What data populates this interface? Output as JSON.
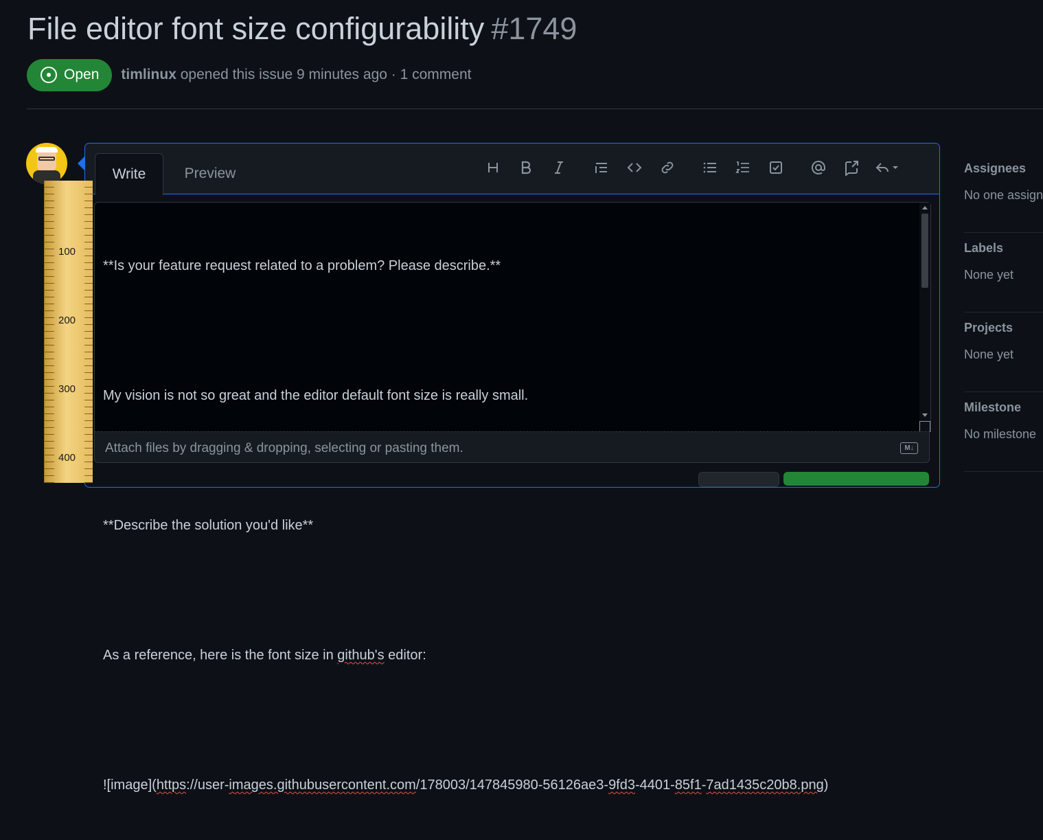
{
  "issue": {
    "title": "File editor font size configurability",
    "number": "#1749",
    "state": "Open",
    "author": "timlinux",
    "meta_rest": " opened this issue 9 minutes ago · 1 comment"
  },
  "editor_tabs": {
    "write": "Write",
    "preview": "Preview"
  },
  "toolbar_icons": [
    "heading-icon",
    "bold-icon",
    "italic-icon",
    "quote-icon",
    "code-icon",
    "link-icon",
    "bulleted-list-icon",
    "numbered-list-icon",
    "task-list-icon",
    "mention-icon",
    "reference-icon",
    "reply-icon"
  ],
  "ruler": {
    "labels": [
      "100",
      "200",
      "300",
      "400"
    ]
  },
  "editor": {
    "line1": "**Is your feature request related to a problem? Please describe.**",
    "line2": "My vision is not so great and the editor default font size is really small.",
    "line3": "**Describe the solution you'd like**",
    "line4_a": "As a reference, here is the font size in ",
    "line4_b": "github's",
    "line4_c": " editor:",
    "line5_a": "![image](",
    "line5_b": "https",
    "line5_c": "://user-",
    "line5_d": "images.githubusercontent.com",
    "line5_e": "/178003/147845980-56126ae3-",
    "line5_f": "9fd3",
    "line5_g": "-4401-",
    "line5_h": "85f1",
    "line5_i": "-",
    "line5_j": "7ad1435c20b8.png",
    "line5_k": ")"
  },
  "attach": {
    "text": "Attach files by dragging & dropping, selecting or pasting them.",
    "md_badge": "M↓"
  },
  "sidebar": {
    "assignees": {
      "heading": "Assignees",
      "value": "No one assign"
    },
    "labels": {
      "heading": "Labels",
      "value": "None yet"
    },
    "projects": {
      "heading": "Projects",
      "value": "None yet"
    },
    "milestone": {
      "heading": "Milestone",
      "value": "No milestone"
    }
  },
  "colors": {
    "background": "#0d1117",
    "accent": "#1f6feb",
    "open_green": "#238636"
  }
}
